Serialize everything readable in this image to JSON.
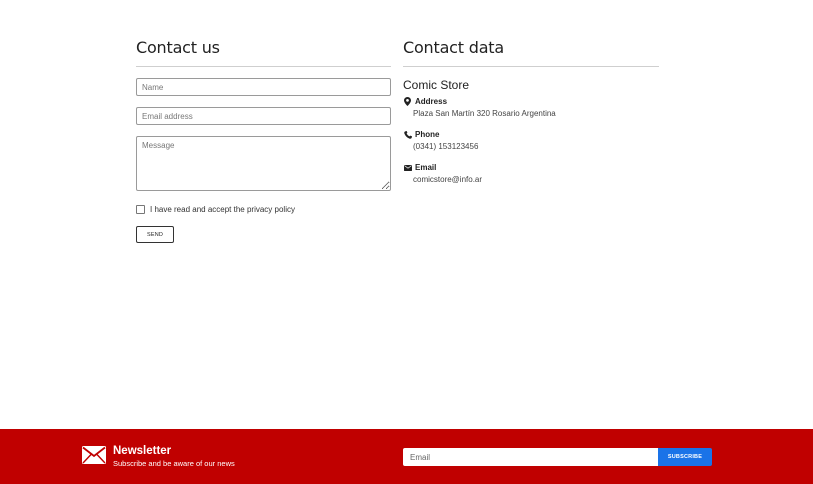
{
  "contact_form": {
    "title": "Contact us",
    "name_placeholder": "Name",
    "email_placeholder": "Email address",
    "message_placeholder": "Message",
    "privacy_label": "I have read and accept the privacy policy",
    "send_label": "SEND"
  },
  "contact_data": {
    "title": "Contact data",
    "store_name": "Comic Store",
    "items": [
      {
        "icon": "map-marker-icon",
        "title": "Address",
        "value": "Plaza San Martín 320 Rosario Argentina"
      },
      {
        "icon": "phone-icon",
        "title": "Phone",
        "value": "(0341) 153123456"
      },
      {
        "icon": "envelope-icon",
        "title": "Email",
        "value": "comicstore@info.ar"
      }
    ]
  },
  "newsletter": {
    "icon": "envelope-icon",
    "title": "Newsletter",
    "subtitle": "Subscribe and be aware of our news",
    "email_placeholder": "Email",
    "subscribe_label": "SUBSCRIBE",
    "background_color": "#c00000",
    "button_color": "#1a73e8"
  }
}
